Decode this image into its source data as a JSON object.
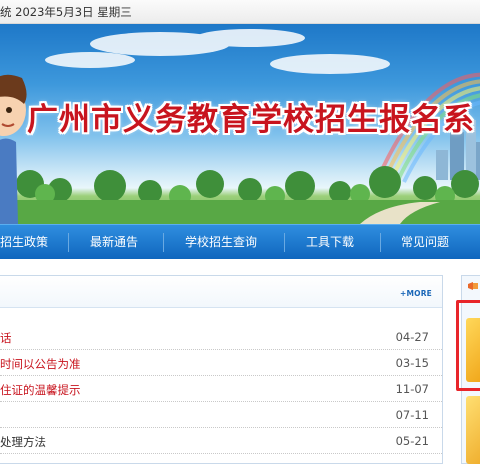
{
  "topbar": {
    "text": "统 2023年5月3日 星期三"
  },
  "banner": {
    "title": "广州市义务教育学校招生报名系"
  },
  "nav": {
    "items": [
      {
        "label": "招生政策"
      },
      {
        "label": "最新通告"
      },
      {
        "label": "学校招生查询"
      },
      {
        "label": "工具下载"
      },
      {
        "label": "常见问题"
      }
    ]
  },
  "news": {
    "more_label": "+MORE",
    "rows": [
      {
        "title": "话",
        "date": "04-27",
        "color": "#c8141e"
      },
      {
        "title": "时间以公告为准",
        "date": "03-15",
        "color": "#c8141e"
      },
      {
        "title": "住证的温馨提示",
        "date": "11-07",
        "color": "#c8141e"
      },
      {
        "title": "",
        "date": "07-11",
        "color": "#333333"
      },
      {
        "title": "处理方法",
        "date": "05-21",
        "color": "#333333"
      }
    ]
  },
  "colors": {
    "nav_bg": "#1a74cc",
    "title_red": "#c8141e",
    "highlight_box": "#e8252a",
    "card_gold": "#f1a81c"
  }
}
